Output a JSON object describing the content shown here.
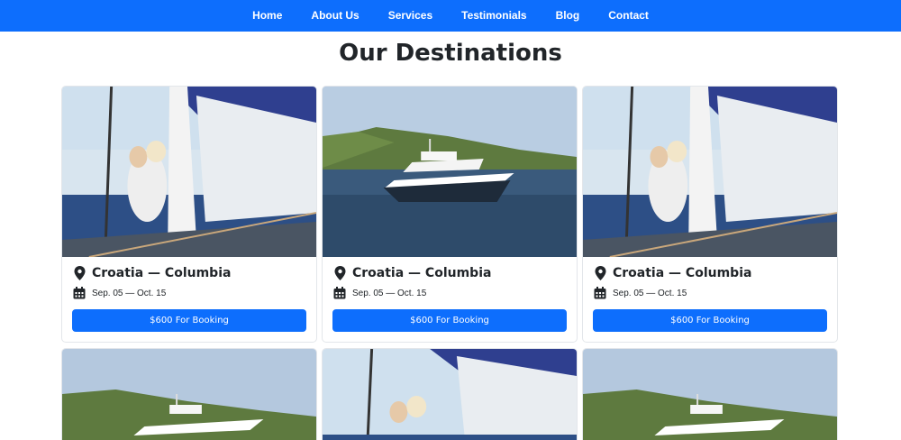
{
  "nav": {
    "items": [
      "Home",
      "About Us",
      "Services",
      "Testimonials",
      "Blog",
      "Contact"
    ]
  },
  "section": {
    "title": "Our Destinations"
  },
  "cards": [
    {
      "image": "sailboat-couple",
      "destination": "Croatia — Columbia",
      "dates": "Sep. 05 — Oct. 15",
      "button": "$600 For Booking"
    },
    {
      "image": "yacht",
      "destination": "Croatia — Columbia",
      "dates": "Sep. 05 — Oct. 15",
      "button": "$600 For Booking"
    },
    {
      "image": "sailboat-couple",
      "destination": "Croatia — Columbia",
      "dates": "Sep. 05 — Oct. 15",
      "button": "$600 For Booking"
    },
    {
      "image": "yacht"
    },
    {
      "image": "sailboat-couple"
    },
    {
      "image": "yacht"
    }
  ],
  "icons": {
    "location": "map-pin-icon",
    "calendar": "calendar-icon"
  },
  "colors": {
    "primary": "#0d6efd",
    "text": "#212529"
  }
}
